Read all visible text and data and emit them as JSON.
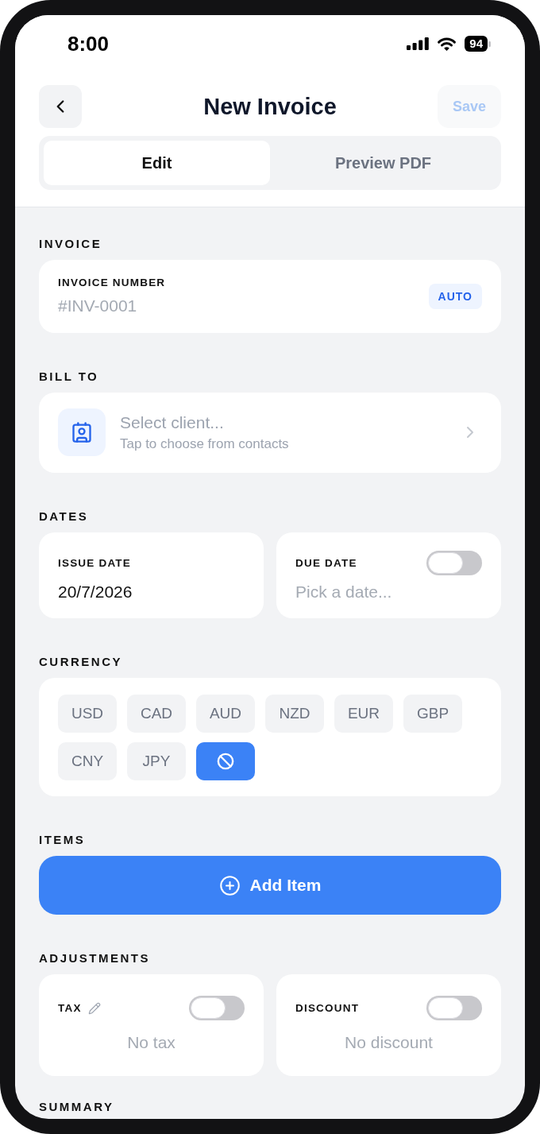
{
  "status_bar": {
    "time": "8:00",
    "battery": "94"
  },
  "header": {
    "title": "New Invoice",
    "save_button": {
      "label": "Save",
      "disabled": true
    }
  },
  "tabs": [
    {
      "label": "Edit",
      "selected": true
    },
    {
      "label": "Preview PDF",
      "selected": false
    }
  ],
  "invoice": {
    "heading": "INVOICE",
    "field_label": "INVOICE NUMBER",
    "placeholder": "#INV-0001",
    "badge": "AUTO"
  },
  "bill_to": {
    "heading": "BILL TO",
    "placeholder": "Select client...",
    "hint": "Tap to choose from contacts"
  },
  "dates": {
    "heading": "DATES",
    "issue_date": {
      "label": "ISSUE DATE",
      "value": "20/7/2026"
    },
    "due_date": {
      "label": "DUE DATE",
      "on": false,
      "placeholder": "Pick a date..."
    }
  },
  "currency": {
    "heading": "CURRENCY",
    "options": [
      {
        "kind": "code",
        "label": "USD",
        "selected": false
      },
      {
        "kind": "code",
        "label": "CAD",
        "selected": false
      },
      {
        "kind": "code",
        "label": "AUD",
        "selected": false
      },
      {
        "kind": "code",
        "label": "NZD",
        "selected": false
      },
      {
        "kind": "code",
        "label": "EUR",
        "selected": false
      },
      {
        "kind": "code",
        "label": "GBP",
        "selected": false
      },
      {
        "kind": "code",
        "label": "CNY",
        "selected": false
      },
      {
        "kind": "code",
        "label": "JPY",
        "selected": false
      },
      {
        "kind": "none",
        "selected": true
      }
    ]
  },
  "items": {
    "heading": "ITEMS",
    "add_button": "Add Item"
  },
  "adjustments": {
    "heading": "ADJUSTMENTS",
    "tax": {
      "label": "TAX",
      "editable": true,
      "on": false,
      "empty_text": "No tax"
    },
    "discount": {
      "label": "DISCOUNT",
      "editable": false,
      "on": false,
      "empty_text": "No discount"
    }
  },
  "summary": {
    "heading": "SUMMARY"
  }
}
